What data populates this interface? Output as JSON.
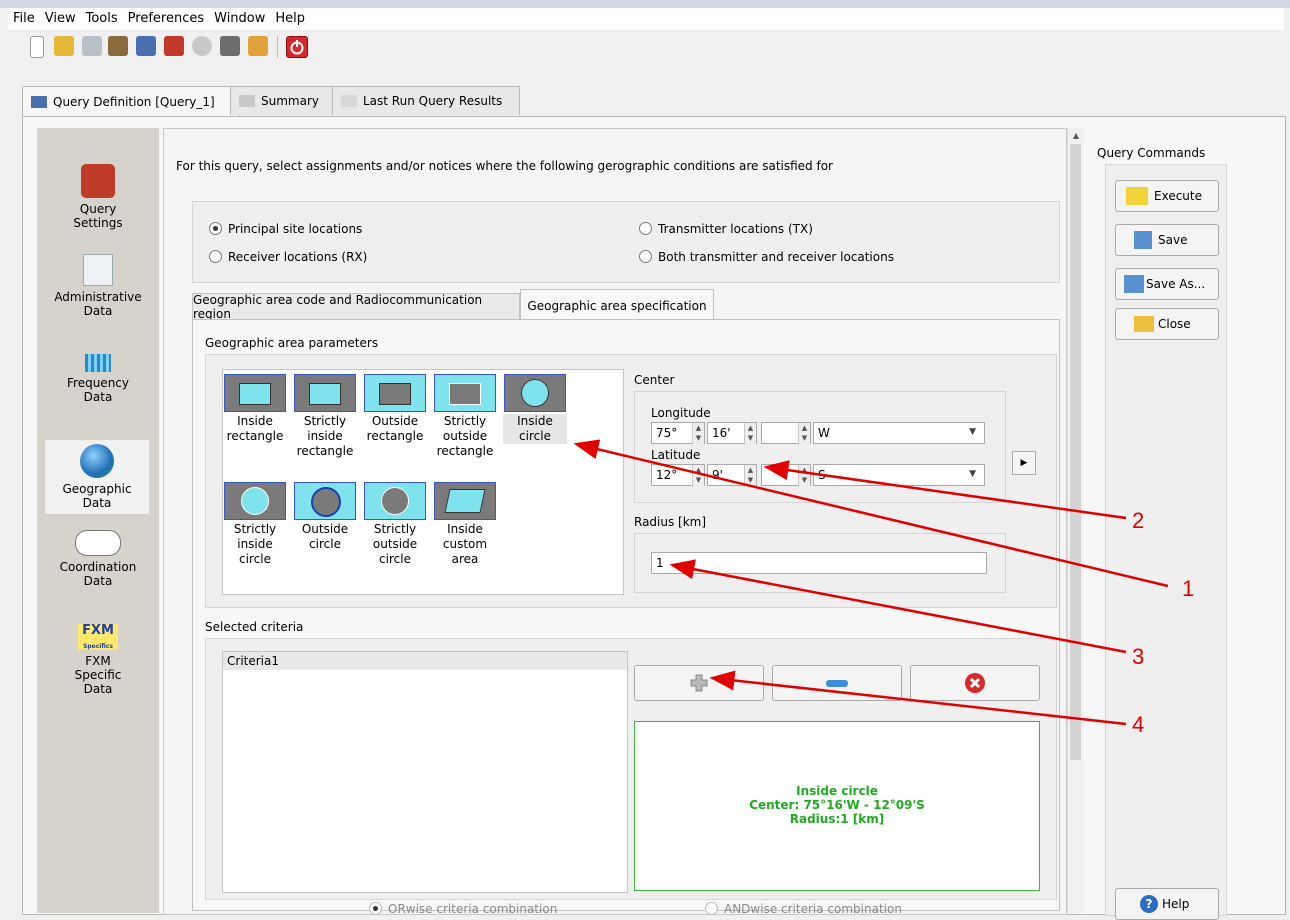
{
  "menu": [
    "File",
    "View",
    "Tools",
    "Preferences",
    "Window",
    "Help"
  ],
  "tabs": [
    "Query Definition [Query_1]",
    "Summary",
    "Last Run Query Results"
  ],
  "sidebar": [
    "Query\nSettings",
    "Administrative\nData",
    "Frequency\nData",
    "Geographic\nData",
    "Coordination\nData",
    "FXM\nSpecific\nData"
  ],
  "fxm_logo": "FXM",
  "fxm_logo_sub": "Specifics",
  "intro": "For this query, select assignments and/or notices where the following gerographic conditions are satisfied for",
  "location_options": [
    "Principal site locations",
    "Transmitter locations (TX)",
    "Receiver locations (RX)",
    "Both transmitter and receiver locations"
  ],
  "sub_tabs": [
    "Geographic area code and Radiocommunication region",
    "Geographic area specification"
  ],
  "params_label": "Geographic area parameters",
  "shapes": [
    "Inside\nrectangle",
    "Strictly\ninside\nrectangle",
    "Outside\nrectangle",
    "Strictly\noutside\nrectangle",
    "Inside\ncircle",
    "Strictly\ninside\ncircle",
    "Outside\ncircle",
    "Strictly\noutside\ncircle",
    "Inside\ncustom\narea"
  ],
  "center": {
    "label": "Center",
    "longitude_label": "Longitude",
    "lon_deg": "75°",
    "lon_min": "16'",
    "lon_sec": "",
    "lon_dir": "W",
    "latitude_label": "Latitude",
    "lat_deg": "12°",
    "lat_min": "9'",
    "lat_sec": "",
    "lat_dir": "S"
  },
  "radius": {
    "label": "Radius [km]",
    "value": "1"
  },
  "selected_label": "Selected criteria",
  "criteria": [
    "Criteria1"
  ],
  "summary": {
    "line1": "Inside circle",
    "line2": "Center: 75°16'W - 12°09'S",
    "line3": "Radius:1 [km]"
  },
  "combine": [
    "ORwise criteria combination",
    "ANDwise criteria combination"
  ],
  "commands": {
    "title": "Query Commands",
    "execute": "Execute",
    "save": "Save",
    "save_as": "Save As...",
    "close": "Close",
    "help": "Help"
  },
  "callouts": [
    "1",
    "2",
    "3",
    "4"
  ],
  "colors": {
    "accent_red": "#e00000",
    "summary_green": "#1faa1f",
    "tile_blue": "#3a55c8",
    "sidebar_bg": "#d6d2cc"
  }
}
